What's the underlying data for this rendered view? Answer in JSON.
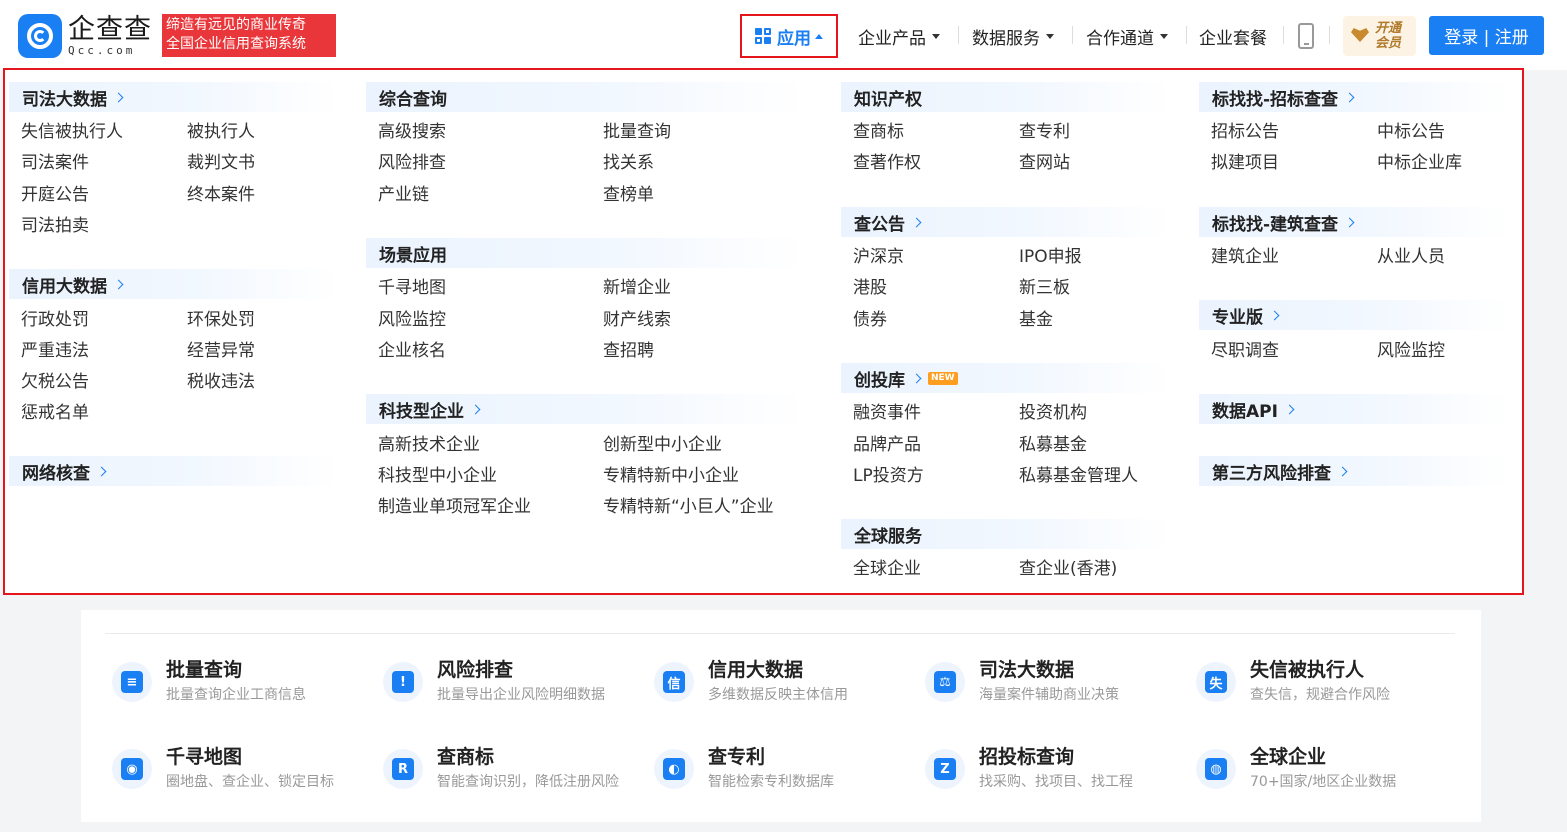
{
  "logo": {
    "cn": "企查查",
    "en": "Qcc.com"
  },
  "slogan": [
    "缔造有远见的商业传奇",
    "全国企业信用查询系统"
  ],
  "nav": {
    "app": "应用",
    "items": [
      "企业产品",
      "数据服务",
      "合作通道",
      "企业套餐"
    ],
    "vip": [
      "开通",
      "会员"
    ],
    "login": "登录 | 注册"
  },
  "menu": {
    "judicial": {
      "title": "司法大数据",
      "links": [
        "失信被执行人",
        "被执行人",
        "司法案件",
        "裁判文书",
        "开庭公告",
        "终本案件",
        "司法拍卖"
      ]
    },
    "credit": {
      "title": "信用大数据",
      "links": [
        "行政处罚",
        "环保处罚",
        "严重违法",
        "经营异常",
        "欠税公告",
        "税收违法",
        "惩戒名单"
      ]
    },
    "network": {
      "title": "网络核查"
    },
    "comprehensive": {
      "title": "综合查询",
      "links": [
        "高级搜索",
        "批量查询",
        "风险排查",
        "找关系",
        "产业链",
        "查榜单"
      ]
    },
    "scenario": {
      "title": "场景应用",
      "links": [
        "千寻地图",
        "新增企业",
        "风险监控",
        "财产线索",
        "企业核名",
        "查招聘"
      ]
    },
    "tech": {
      "title": "科技型企业",
      "links": [
        "高新技术企业",
        "创新型中小企业",
        "科技型中小企业",
        "专精特新中小企业",
        "制造业单项冠军企业",
        "专精特新“小巨人”企业"
      ]
    },
    "ip": {
      "title": "知识产权",
      "links": [
        "查商标",
        "查专利",
        "查著作权",
        "查网站"
      ]
    },
    "announce": {
      "title": "查公告",
      "links": [
        "沪深京",
        "IPO申报",
        "港股",
        "新三板",
        "债券",
        "基金"
      ]
    },
    "venture": {
      "title": "创投库",
      "badge": "NEW",
      "links": [
        "融资事件",
        "投资机构",
        "品牌产品",
        "私募基金",
        "LP投资方",
        "私募基金管理人"
      ]
    },
    "global": {
      "title": "全球服务",
      "links": [
        "全球企业",
        "查企业(香港)"
      ]
    },
    "bid": {
      "title": "标找找-招标查查",
      "links": [
        "招标公告",
        "中标公告",
        "拟建项目",
        "中标企业库"
      ]
    },
    "build": {
      "title": "标找找-建筑查查",
      "links": [
        "建筑企业",
        "从业人员"
      ]
    },
    "pro": {
      "title": "专业版",
      "links": [
        "尽职调查",
        "风险监控"
      ]
    },
    "api": {
      "title": "数据API"
    },
    "third": {
      "title": "第三方风险排查"
    }
  },
  "features": [
    {
      "title": "批量查询",
      "desc": "批量查询企业工商信息",
      "icon": "batch-query-icon",
      "glyph": "≡"
    },
    {
      "title": "风险排查",
      "desc": "批量导出企业风险明细数据",
      "icon": "risk-check-icon",
      "glyph": "!"
    },
    {
      "title": "信用大数据",
      "desc": "多维数据反映主体信用",
      "icon": "credit-data-icon",
      "glyph": "信"
    },
    {
      "title": "司法大数据",
      "desc": "海量案件辅助商业决策",
      "icon": "judicial-data-icon",
      "glyph": "⚖"
    },
    {
      "title": "失信被执行人",
      "desc": "查失信，规避合作风险",
      "icon": "dishonest-icon",
      "glyph": "失"
    },
    {
      "title": "千寻地图",
      "desc": "圈地盘、查企业、锁定目标",
      "icon": "map-pin-icon",
      "glyph": "◉"
    },
    {
      "title": "查商标",
      "desc": "智能查询识别，降低注册风险",
      "icon": "trademark-icon",
      "glyph": "R"
    },
    {
      "title": "查专利",
      "desc": "智能检索专利数据库",
      "icon": "patent-icon",
      "glyph": "◐"
    },
    {
      "title": "招投标查询",
      "desc": "找采购、找项目、找工程",
      "icon": "bidding-icon",
      "glyph": "Z"
    },
    {
      "title": "全球企业",
      "desc": "70+国家/地区企业数据",
      "icon": "globe-icon",
      "glyph": "◍"
    }
  ]
}
